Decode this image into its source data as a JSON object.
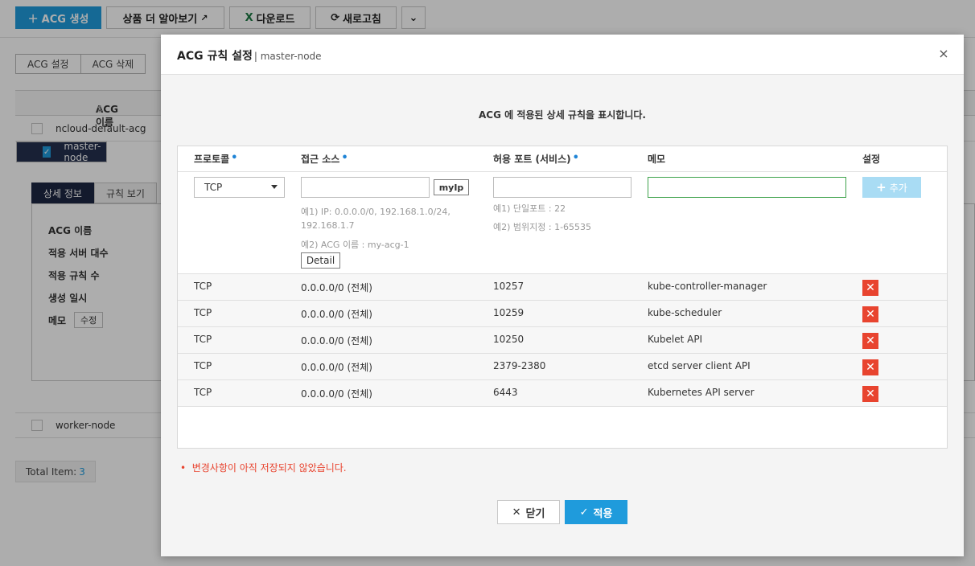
{
  "toolbar": {
    "create_label": "ACG 생성",
    "learn_label": "상품 더 알아보기",
    "download_label": "다운로드",
    "refresh_label": "새로고침"
  },
  "acg_actions": {
    "settings_label": "ACG 설정",
    "delete_label": "ACG 삭제"
  },
  "acg_list": {
    "header_name": "ACG 이름",
    "rows": [
      {
        "name": "ncloud-default-acg",
        "selected": false
      },
      {
        "name": "master-node",
        "selected": true
      },
      {
        "name": "worker-node",
        "selected": false
      }
    ]
  },
  "detail": {
    "tabs": [
      "상세 정보",
      "규칙 보기"
    ],
    "labels": [
      "ACG 이름",
      "적용 서버 대수",
      "적용 규칙 수",
      "생성 일시",
      "메모"
    ],
    "edit_label": "수정"
  },
  "total": {
    "label": "Total Item:",
    "count": "3"
  },
  "modal": {
    "title": "ACG 규칙 설정",
    "subtitle": "| master-node",
    "close_icon": "×",
    "description": "ACG 에 적용된 상세 규칙을 표시합니다.",
    "columns": {
      "protocol": "프로토콜",
      "source": "접근 소스",
      "port": "허용 포트 (서비스)",
      "memo": "메모",
      "setting": "설정"
    },
    "form": {
      "protocol_value": "TCP",
      "source_value": "",
      "myip_label": "myIp",
      "source_hint1": "예1) IP: 0.0.0.0/0, 192.168.1.0/24, 192.168.1.7",
      "source_hint2": "예2) ACG 이름 : my-acg-1",
      "detail_label": "Detail",
      "port_value": "",
      "port_hint1": "예1) 단일포트 : 22",
      "port_hint2": "예2) 범위지정 : 1-65535",
      "memo_value": "",
      "add_label": "추가"
    },
    "rules": [
      {
        "protocol": "TCP",
        "source": "0.0.0.0/0 (전체)",
        "port": "10257",
        "memo": "kube-controller-manager"
      },
      {
        "protocol": "TCP",
        "source": "0.0.0.0/0 (전체)",
        "port": "10259",
        "memo": "kube-scheduler"
      },
      {
        "protocol": "TCP",
        "source": "0.0.0.0/0 (전체)",
        "port": "10250",
        "memo": "Kubelet API"
      },
      {
        "protocol": "TCP",
        "source": "0.0.0.0/0 (전체)",
        "port": "2379-2380",
        "memo": "etcd server client API"
      },
      {
        "protocol": "TCP",
        "source": "0.0.0.0/0 (전체)",
        "port": "6443",
        "memo": "Kubernetes API server"
      }
    ],
    "warning": "변경사항이 아직 저장되지 않았습니다.",
    "close_label": "닫기",
    "apply_label": "적용"
  },
  "colors": {
    "primary": "#1f9bdc",
    "danger": "#e8442f",
    "selected_row": "#24304f"
  }
}
